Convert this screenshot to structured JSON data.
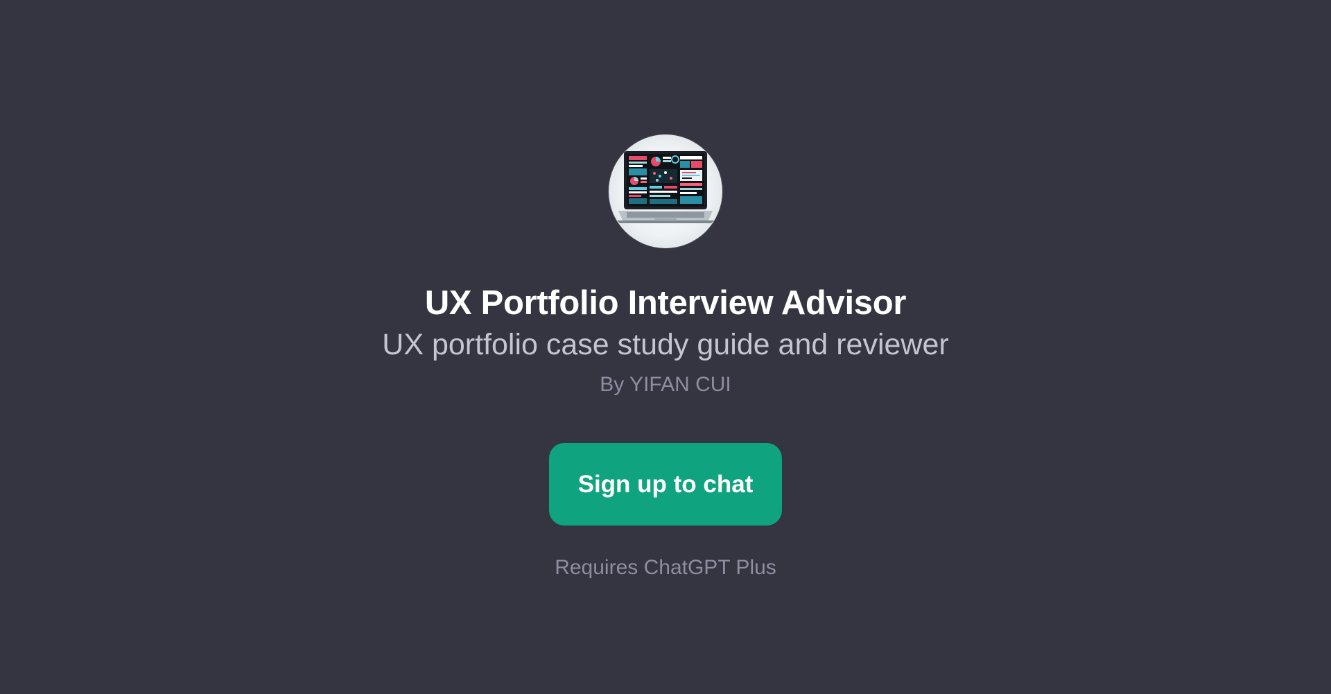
{
  "gpt": {
    "avatar_icon": "laptop-dashboard-icon",
    "title": "UX Portfolio Interview Advisor",
    "subtitle": "UX portfolio case study guide and reviewer",
    "author": "By YIFAN CUI"
  },
  "actions": {
    "signup_label": "Sign up to chat",
    "requirement": "Requires ChatGPT Plus"
  },
  "colors": {
    "background": "#343541",
    "accent": "#10a37f",
    "title": "#ffffff",
    "subtitle": "#c5c5d2",
    "muted": "#8e8ea0"
  }
}
